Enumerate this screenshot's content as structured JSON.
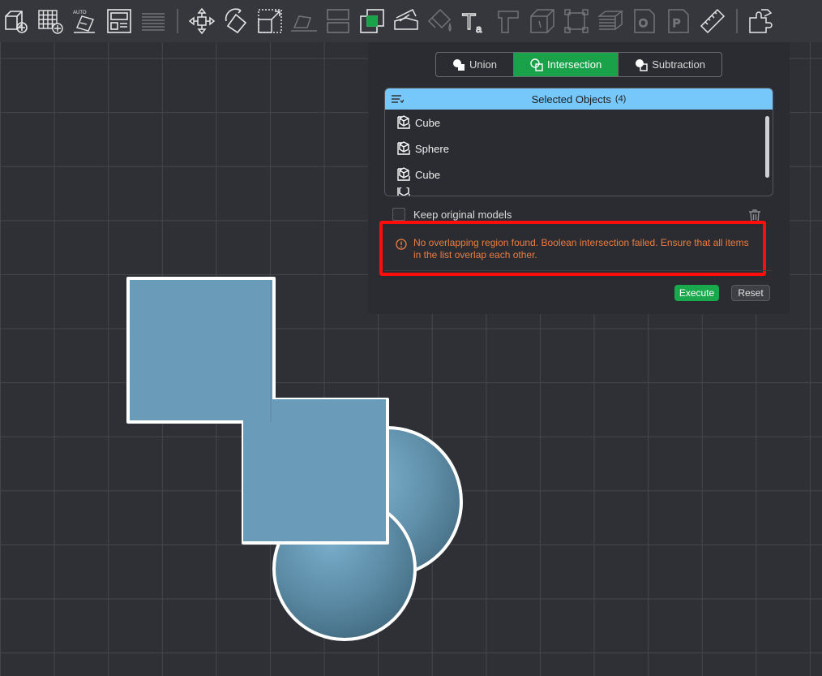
{
  "toolbar": {
    "tools": [
      {
        "icon": "add-cube-icon",
        "enabled": true
      },
      {
        "icon": "grid-add-icon",
        "enabled": true
      },
      {
        "icon": "auto-arrange-icon",
        "enabled": true,
        "label": "AUTO"
      },
      {
        "icon": "layout-icon",
        "enabled": true
      },
      {
        "icon": "layers-icon",
        "enabled": false
      },
      {
        "icon": "move-icon",
        "enabled": true
      },
      {
        "icon": "rotate-icon",
        "enabled": true
      },
      {
        "icon": "scale-icon",
        "enabled": true
      },
      {
        "icon": "lay-flat-icon",
        "enabled": false
      },
      {
        "icon": "split-icon",
        "enabled": false
      },
      {
        "icon": "boolean-icon",
        "enabled": true
      },
      {
        "icon": "cut-icon",
        "enabled": true
      },
      {
        "icon": "paint-icon",
        "enabled": false
      },
      {
        "icon": "text-icon",
        "enabled": true,
        "label": "T",
        "sublabel": "a"
      },
      {
        "icon": "support-paint-icon",
        "enabled": false
      },
      {
        "icon": "seam-icon",
        "enabled": false
      },
      {
        "icon": "measure-box-icon",
        "enabled": false
      },
      {
        "icon": "variable-layer-icon",
        "enabled": false
      },
      {
        "icon": "emboss-o-icon",
        "enabled": false,
        "label": "O"
      },
      {
        "icon": "emboss-p-icon",
        "enabled": false,
        "label": "P"
      },
      {
        "icon": "ruler-icon",
        "enabled": true
      },
      {
        "icon": "assembly-icon",
        "enabled": true
      }
    ]
  },
  "boolean_panel": {
    "tabs": [
      {
        "label": "Union",
        "active": false
      },
      {
        "label": "Intersection",
        "active": true
      },
      {
        "label": "Subtraction",
        "active": false
      }
    ],
    "list_title": "Selected Objects",
    "list_count": "(4)",
    "objects": [
      {
        "name": "Cube"
      },
      {
        "name": "Sphere"
      },
      {
        "name": "Cube"
      }
    ],
    "keep_original_label": "Keep original models",
    "keep_original_checked": false,
    "error_message": "No overlapping region found. Boolean intersection failed. Ensure that all items in the list overlap each other.",
    "execute_label": "Execute",
    "reset_label": "Reset"
  },
  "colors": {
    "accent_green": "#19a24a",
    "list_header": "#77c8fa",
    "error_text": "#ec7c40",
    "highlight_border": "#ff0d0d",
    "model_fill": "#6a9bb8"
  }
}
